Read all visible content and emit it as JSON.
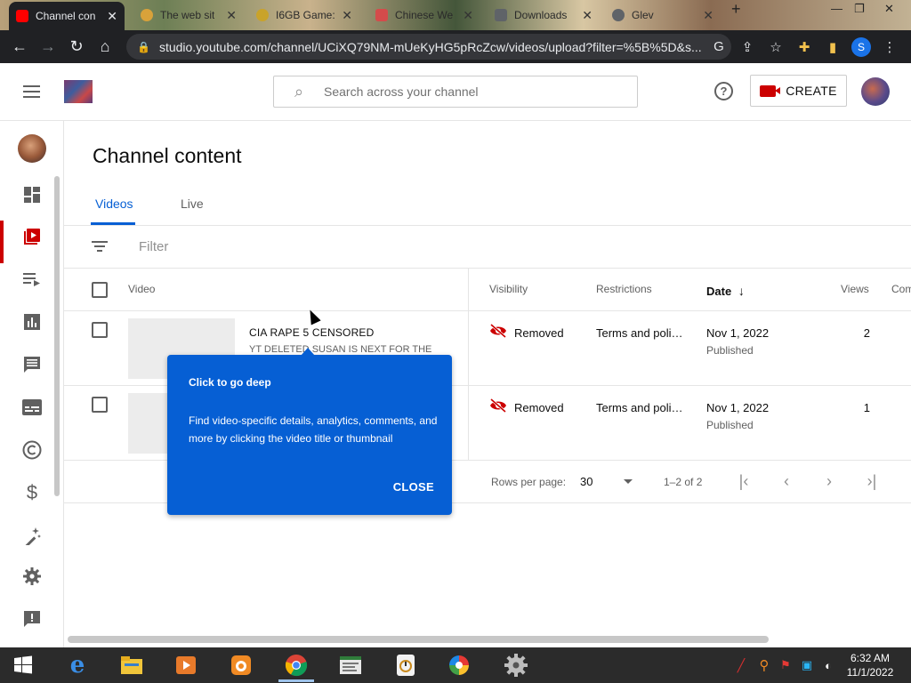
{
  "browser": {
    "tabs": [
      {
        "title": "Channel con",
        "active": true,
        "favicon_color": "#ff0000"
      },
      {
        "title": "The web sit",
        "active": false,
        "favicon_color": "#d9a23a"
      },
      {
        "title": "I6GB Game:",
        "active": false,
        "favicon_color": "#c9a32a"
      },
      {
        "title": "Chinese We",
        "active": false,
        "favicon_color": "#d44b4b"
      },
      {
        "title": "Downloads",
        "active": false,
        "favicon_color": "#5f6368"
      },
      {
        "title": "Glev",
        "active": false,
        "favicon_color": "#5f6368"
      }
    ],
    "url": "studio.youtube.com/channel/UCiXQ79NM-mUeKyHG5pRcZcw/videos/upload?filter=%5B%5D&s...",
    "profile_letter": "S"
  },
  "header": {
    "search_placeholder": "Search across your channel",
    "create_label": "CREATE"
  },
  "page": {
    "title": "Channel content",
    "tabs": [
      {
        "label": "Videos",
        "active": true
      },
      {
        "label": "Live",
        "active": false
      }
    ],
    "filter_placeholder": "Filter"
  },
  "table": {
    "columns": {
      "video": "Video",
      "visibility": "Visibility",
      "restrictions": "Restrictions",
      "date": "Date",
      "views": "Views",
      "comments": "Com"
    },
    "rows": [
      {
        "title": "CIA RAPE 5 CENSORED",
        "description": "YT DELETED SUSAN IS NEXT FOR THE",
        "visibility": "Removed",
        "restrictions": "Terms and poli…",
        "date": "Nov 1, 2022",
        "status": "Published",
        "views": "2"
      },
      {
        "title": "",
        "description": "",
        "visibility": "Removed",
        "restrictions": "Terms and poli…",
        "date": "Nov 1, 2022",
        "status": "Published",
        "views": "1"
      }
    ]
  },
  "pager": {
    "rows_per_page_label": "Rows per page:",
    "rows_per_page_value": "30",
    "range": "1–2 of 2"
  },
  "tooltip": {
    "title": "Click to go deep",
    "body": "Find video-specific details, analytics, comments, and more by clicking the video title or thumbnail",
    "close": "CLOSE"
  },
  "taskbar": {
    "time": "6:32 AM",
    "date": "11/1/2022"
  },
  "colors": {
    "accent_blue": "#065fd4",
    "brand_red": "#cc0000"
  }
}
